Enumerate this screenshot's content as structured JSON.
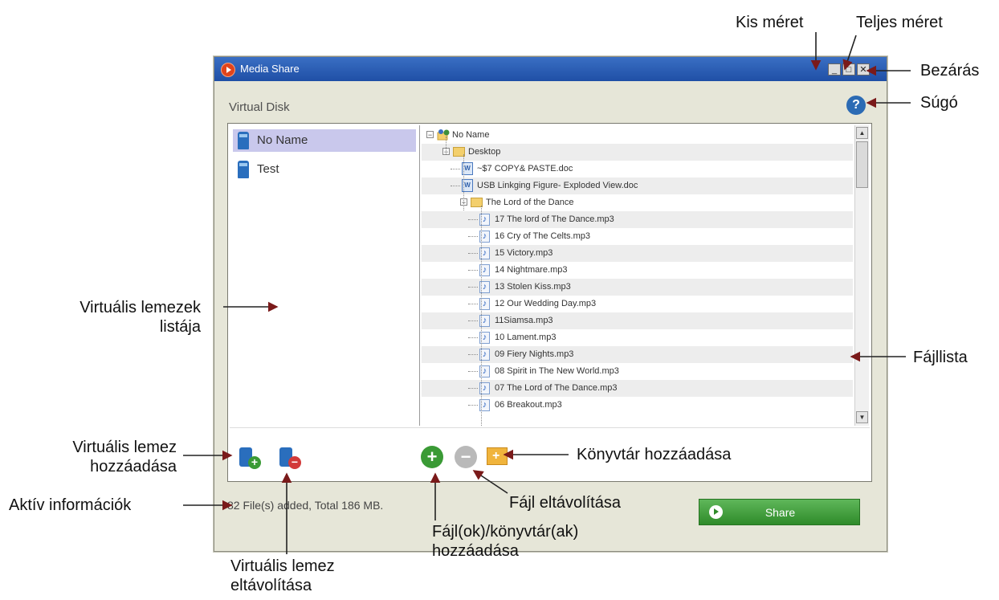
{
  "window": {
    "title": "Media Share",
    "section_label": "Virtual Disk",
    "help_glyph": "?",
    "titlebar_buttons": {
      "minimize": "_",
      "maximize": "□",
      "close": "✕"
    }
  },
  "disks": [
    {
      "name": "No Name",
      "selected": true,
      "icon": "usb-drive-icon"
    },
    {
      "name": "Test",
      "selected": false,
      "icon": "usb-drive-icon"
    }
  ],
  "file_tree": [
    {
      "label": "No Name",
      "type": "root",
      "depth": 0,
      "expander": "−"
    },
    {
      "label": "Desktop",
      "type": "folder",
      "depth": 1,
      "expander": "−"
    },
    {
      "label": "~$7 COPY& PASTE.doc",
      "type": "doc",
      "depth": 2
    },
    {
      "label": "USB Linkging Figure- Exploded View.doc",
      "type": "doc",
      "depth": 2
    },
    {
      "label": "The Lord of the Dance",
      "type": "folder",
      "depth": 2,
      "expander": "−"
    },
    {
      "label": "17 The lord of The Dance.mp3",
      "type": "mp3",
      "depth": 3
    },
    {
      "label": "16 Cry of The Celts.mp3",
      "type": "mp3",
      "depth": 3
    },
    {
      "label": "15 Victory.mp3",
      "type": "mp3",
      "depth": 3
    },
    {
      "label": "14 Nightmare.mp3",
      "type": "mp3",
      "depth": 3
    },
    {
      "label": "13 Stolen Kiss.mp3",
      "type": "mp3",
      "depth": 3
    },
    {
      "label": "12 Our Wedding Day.mp3",
      "type": "mp3",
      "depth": 3
    },
    {
      "label": "11Siamsa.mp3",
      "type": "mp3",
      "depth": 3
    },
    {
      "label": "10 Lament.mp3",
      "type": "mp3",
      "depth": 3
    },
    {
      "label": "09 Fiery Nights.mp3",
      "type": "mp3",
      "depth": 3
    },
    {
      "label": "08 Spirit in The New World.mp3",
      "type": "mp3",
      "depth": 3
    },
    {
      "label": "07 The Lord of The Dance.mp3",
      "type": "mp3",
      "depth": 3
    },
    {
      "label": "06 Breakout.mp3",
      "type": "mp3",
      "depth": 3
    }
  ],
  "status": {
    "text": "82 File(s) added, Total 186 MB."
  },
  "share_button": {
    "label": "Share"
  },
  "toolbar": {
    "add_disk_icon": "add-disk-icon",
    "remove_disk_icon": "remove-disk-icon",
    "add_file_glyph": "+",
    "remove_file_glyph": "−",
    "add_folder_icon": "add-folder-icon"
  },
  "colors": {
    "titlebar": "#1f4fa6",
    "window_bg": "#e6e6d8",
    "selected_disk": "#c9c8ec",
    "share_green": "#2f8b2a",
    "add_green": "#3a9a35",
    "remove_red": "#d23a3a"
  },
  "callouts": {
    "minimize": "Kis méret",
    "maximize": "Teljes méret",
    "close": "Bezárás",
    "help": "Súgó",
    "disk_list_line1": "Virtuális lemezek",
    "disk_list_line2": "listája",
    "file_list": "Fájllista",
    "add_disk_line1": "Virtuális lemez",
    "add_disk_line2": "hozzáadása",
    "active_info": "Aktív információk",
    "add_folder": "Könyvtár hozzáadása",
    "remove_file": "Fájl eltávolítása",
    "add_files_line1": "Fájl(ok)/könyvtár(ak)",
    "add_files_line2": "hozzáadása",
    "remove_disk_line1": "Virtuális lemez",
    "remove_disk_line2": "eltávolítása"
  }
}
